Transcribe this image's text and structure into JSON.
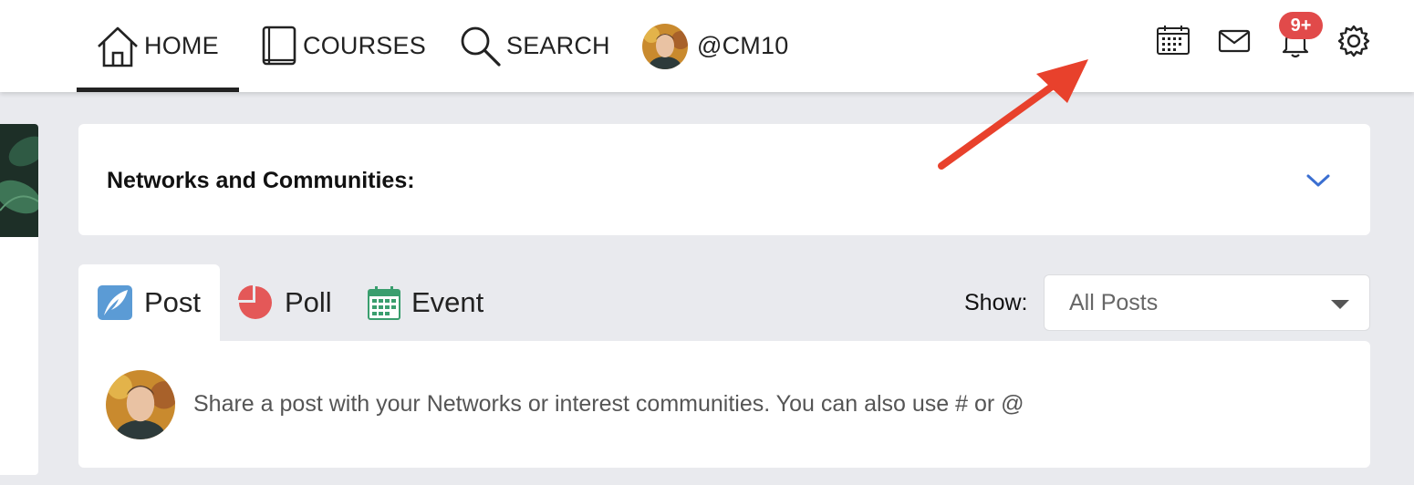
{
  "nav": {
    "home": {
      "label": "HOME",
      "icon": "home-icon"
    },
    "courses": {
      "label": "COURSES",
      "icon": "book-icon"
    },
    "search": {
      "label": "SEARCH",
      "icon": "search-icon"
    },
    "profile": {
      "label": "@CM10",
      "icon": "avatar"
    }
  },
  "top_icons": [
    "calendar-icon",
    "mail-icon",
    "bell-icon",
    "gear-icon"
  ],
  "notifications_badge": "9+",
  "networks": {
    "title": "Networks and Communities:",
    "icon": "chevron-down-icon"
  },
  "composer_tabs": [
    {
      "label": "Post",
      "icon": "feather-icon",
      "active": true
    },
    {
      "label": "Poll",
      "icon": "pie-chart-icon",
      "active": false
    },
    {
      "label": "Event",
      "icon": "calendar-icon",
      "active": false
    }
  ],
  "filter": {
    "label": "Show:",
    "selected": "All Posts"
  },
  "composer": {
    "placeholder": "Share a post with your Networks or interest communities. You can also use # or @"
  },
  "colors": {
    "accent_blue": "#3b6fd1",
    "badge_red": "#e14a4a",
    "annotation_arrow": "#e8412c",
    "page_bg": "#e9eaee"
  }
}
